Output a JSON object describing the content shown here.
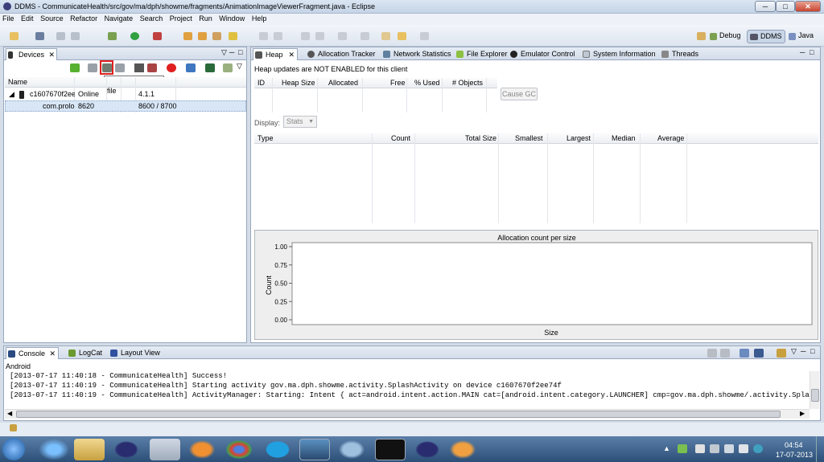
{
  "window": {
    "title": "DDMS - CommunicateHealth/src/gov/ma/dph/showme/fragments/AnimationImageViewerFragment.java - Eclipse",
    "min": "─",
    "max": "□",
    "close": "✕"
  },
  "menu": [
    "File",
    "Edit",
    "Source",
    "Refactor",
    "Navigate",
    "Search",
    "Project",
    "Run",
    "Window",
    "Help"
  ],
  "perspectives": [
    {
      "label": "Debug",
      "active": false
    },
    {
      "label": "DDMS",
      "active": true
    },
    {
      "label": "Java",
      "active": false
    }
  ],
  "devices": {
    "tab": "Devices",
    "tooltip": "Dump HPROF file",
    "header": "Name",
    "rows": [
      {
        "name": "c1607670f2ee74f",
        "col2": "Online",
        "col3": "",
        "col4": "4.1.1"
      },
      {
        "name": "com.prolo",
        "col2": "8620",
        "col3": "",
        "col4": "8600 / 8700"
      }
    ]
  },
  "right_tabs": [
    "Heap",
    "Allocation Tracker",
    "Network Statistics",
    "File Explorer",
    "Emulator Control",
    "System Information",
    "Threads"
  ],
  "heap": {
    "notice": "Heap updates are NOT ENABLED for this client",
    "columns": [
      "ID",
      "Heap Size",
      "Allocated",
      "Free",
      "% Used",
      "# Objects"
    ],
    "cause_gc": "Cause GC",
    "display_label": "Display:",
    "display_value": "Stats",
    "stats_columns": [
      "Type",
      "Count",
      "Total Size",
      "Smallest",
      "Largest",
      "Median",
      "Average"
    ]
  },
  "chart_data": {
    "type": "bar",
    "title": "Allocation count per size",
    "xlabel": "Size",
    "ylabel": "Count",
    "yticks": [
      "1.00",
      "0.75",
      "0.50",
      "0.25",
      "0.00"
    ],
    "ylim": [
      0,
      1
    ],
    "series": []
  },
  "bottom_tabs": [
    "Console",
    "LogCat",
    "Layout View"
  ],
  "console": {
    "context": "Android",
    "lines": [
      "[2013-07-17 11:40:18 - CommunicateHealth] Success!",
      "[2013-07-17 11:40:19 - CommunicateHealth] Starting activity gov.ma.dph.showme.activity.SplashActivity on device c1607670f2ee74f",
      "[2013-07-17 11:40:19 - CommunicateHealth] ActivityManager: Starting: Intent { act=android.intent.action.MAIN cat=[android.intent.category.LAUNCHER] cmp=gov.ma.dph.showme/.activity.SplashActivi"
    ]
  },
  "clock": {
    "time": "04:54",
    "date": "17-07-2013"
  }
}
